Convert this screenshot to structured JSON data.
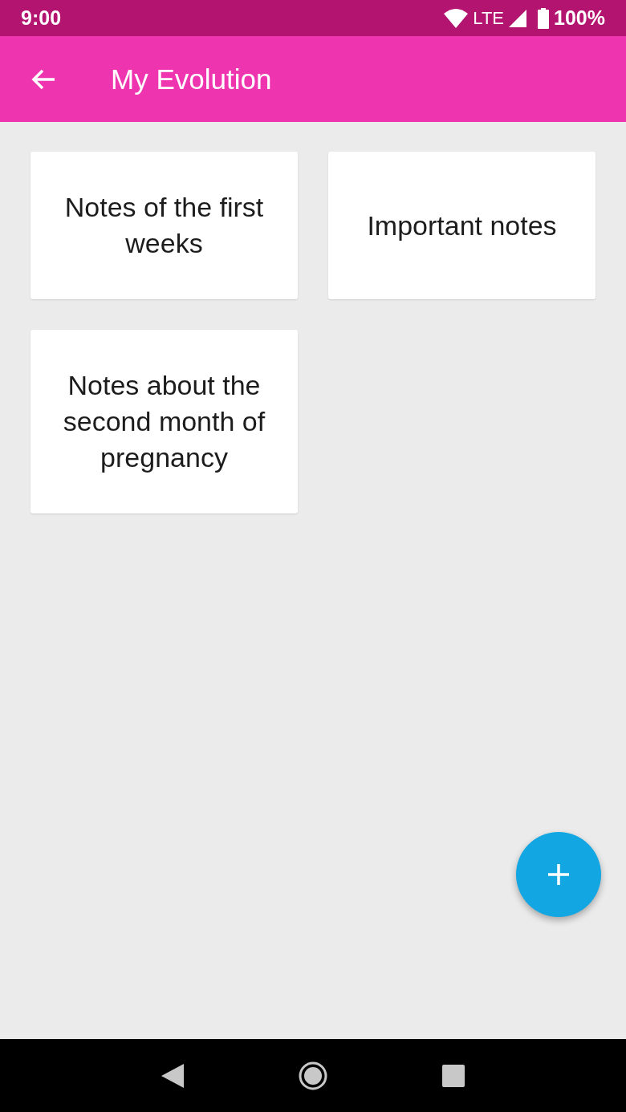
{
  "status_bar": {
    "time": "9:00",
    "network": "LTE",
    "battery": "100%"
  },
  "app_bar": {
    "title": "My Evolution"
  },
  "notes": [
    "Notes of the first weeks",
    "Important notes",
    "Notes about the second month of pregnancy"
  ]
}
